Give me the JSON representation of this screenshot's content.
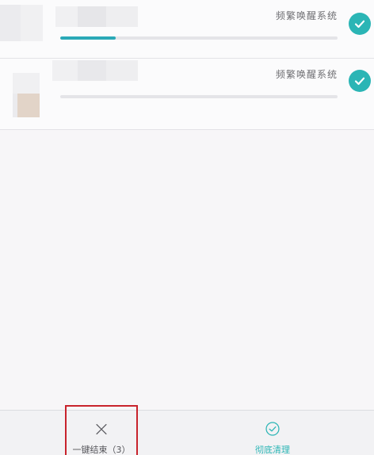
{
  "apps": [
    {
      "reason": "频繁唤醒系统",
      "checked": true,
      "progress": 0.2
    },
    {
      "reason": "频繁唤醒系统",
      "checked": true,
      "progress": 0.0
    }
  ],
  "toolbar": {
    "stop_label": "一键结束（3）",
    "clean_label": "彻底清理"
  },
  "colors": {
    "accent": "#2bb5b5",
    "progress": "#2aa9b7",
    "highlight_box": "#c8232c"
  },
  "icons": {
    "check": "check-circle-icon",
    "stop": "close-x-icon",
    "clean": "check-outline-circle-icon"
  }
}
